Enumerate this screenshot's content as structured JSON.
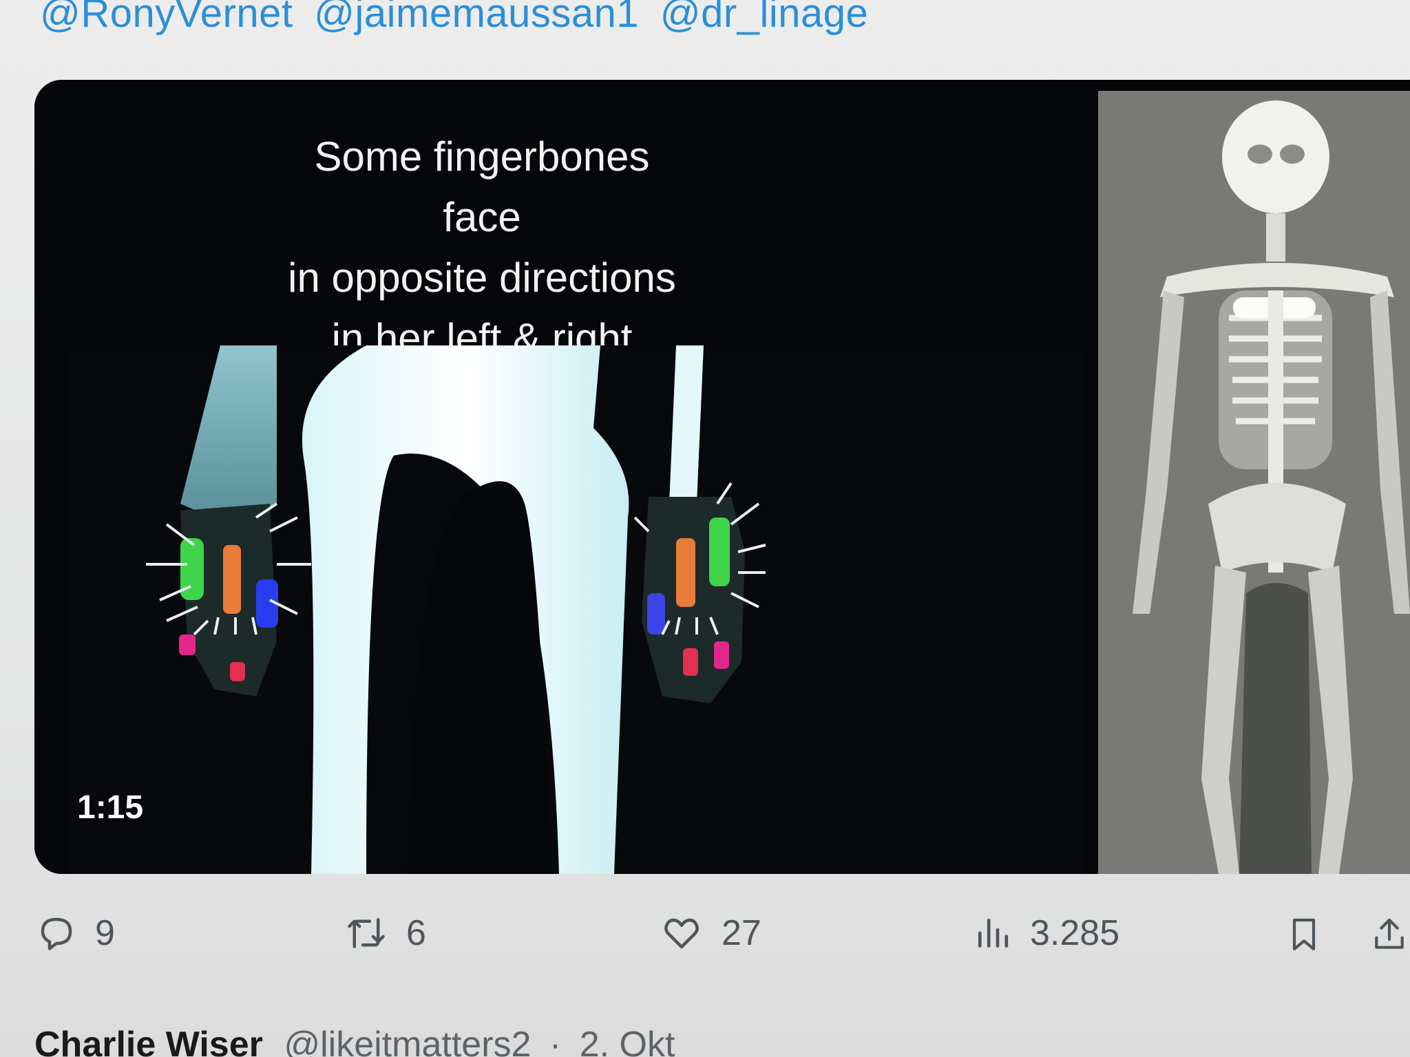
{
  "tweet": {
    "mentions": [
      "@RonyVernet",
      "@jaimemaussan1",
      "@dr_linage"
    ],
    "media": {
      "caption_lines": [
        "Some fingerbones face",
        "in opposite directions",
        "in her left & right hands"
      ],
      "duration": "1:15"
    },
    "actions": {
      "replies": "9",
      "retweets": "6",
      "likes": "27",
      "views": "3.285"
    }
  },
  "next_tweet": {
    "name": "Charlie Wiser",
    "handle": "@likeitmatters2",
    "separator": "·",
    "date": "2. Okt"
  },
  "icons": {
    "reply": "speech-bubble-icon",
    "retweet": "retweet-arrows-icon",
    "like": "heart-icon",
    "views": "bar-chart-icon",
    "bookmark": "bookmark-icon",
    "share": "share-upload-icon"
  },
  "colors": {
    "mention_link": "#2b8fd6",
    "action_gray": "#4e555b",
    "media_background": "#050608"
  }
}
